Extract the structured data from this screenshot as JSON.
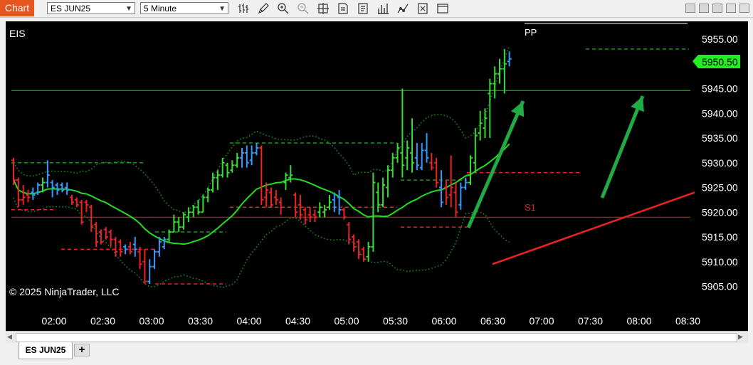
{
  "window": {
    "title": "Chart",
    "instrument": "ES JUN25",
    "interval": "5 Minute",
    "tab_label": "ES JUN25",
    "add_tab_label": "+"
  },
  "toolbar_icons": [
    "bar-type-icon",
    "draw-pencil-icon",
    "zoom-in-icon",
    "zoom-out-icon",
    "crosshair-icon",
    "data-box-icon",
    "properties-icon",
    "strategies-icon",
    "indicators-icon",
    "templates-icon",
    "window-menu-icon"
  ],
  "chart": {
    "instrument_label": "EIS",
    "copyright": "© 2025 NinjaTrader, LLC",
    "price_label": "5950.50",
    "pivot_label": "PP",
    "s1_label": "S1",
    "price_ticks": [
      "5955.00",
      "5950.00",
      "5945.00",
      "5940.00",
      "5935.00",
      "5930.00",
      "5925.00",
      "5920.00",
      "5915.00",
      "5910.00",
      "5905.00"
    ],
    "time_ticks": [
      "02:00",
      "02:30",
      "03:00",
      "03:30",
      "04:00",
      "04:30",
      "05:00",
      "05:30",
      "06:00",
      "06:30",
      "07:00",
      "07:30",
      "08:00",
      "08:30"
    ],
    "colors": {
      "background": "#000000",
      "up_bar": "#33dd33",
      "down_bar": "#ee2222",
      "neutral_bar": "#3399ff",
      "ma": "#22dd22",
      "bollinger": "#1a9a1a",
      "pivot_line": "#22cc22",
      "s1_line": "#dd2222",
      "price_marker": "#22ee22",
      "arrow": "#22aa44"
    }
  },
  "chart_data": {
    "type": "candlestick",
    "instrument": "EIS",
    "interval": "5 Minute",
    "ylim": [
      5903,
      5958
    ],
    "levels": {
      "PP": 5944.6,
      "S1": 5919
    },
    "last_price": 5950.5,
    "bars": [
      {
        "o": 5930.5,
        "h": 5931,
        "l": 5925.5,
        "c": 5926.5,
        "d": "down"
      },
      {
        "o": 5926.5,
        "h": 5927,
        "l": 5921,
        "c": 5922.5,
        "d": "down"
      },
      {
        "o": 5922.5,
        "h": 5925.5,
        "l": 5921.5,
        "c": 5923,
        "d": "down"
      },
      {
        "o": 5923.5,
        "h": 5924.5,
        "l": 5922,
        "c": 5923,
        "d": "down"
      },
      {
        "o": 5924,
        "h": 5925,
        "l": 5922.5,
        "c": 5923.5,
        "d": "neutral"
      },
      {
        "o": 5924,
        "h": 5926,
        "l": 5923.5,
        "c": 5925.5,
        "d": "neutral"
      },
      {
        "o": 5925.5,
        "h": 5927,
        "l": 5924,
        "c": 5926,
        "d": "up"
      },
      {
        "o": 5926,
        "h": 5930.5,
        "l": 5925,
        "c": 5927.5,
        "d": "neutral"
      },
      {
        "o": 5926,
        "h": 5926.5,
        "l": 5923,
        "c": 5925,
        "d": "neutral"
      },
      {
        "o": 5925.5,
        "h": 5926,
        "l": 5923.5,
        "c": 5924.5,
        "d": "neutral"
      },
      {
        "o": 5925.5,
        "h": 5926,
        "l": 5924,
        "c": 5924.5,
        "d": "neutral"
      },
      {
        "o": 5925,
        "h": 5926,
        "l": 5923.5,
        "c": 5924.5,
        "d": "neutral"
      },
      {
        "o": 5923,
        "h": 5923.5,
        "l": 5921.5,
        "c": 5922,
        "d": "down"
      },
      {
        "o": 5922.5,
        "h": 5923,
        "l": 5921,
        "c": 5921.5,
        "d": "down"
      },
      {
        "o": 5922,
        "h": 5922.5,
        "l": 5917.5,
        "c": 5918,
        "d": "down"
      },
      {
        "o": 5922,
        "h": 5922.5,
        "l": 5920,
        "c": 5921.5,
        "d": "down"
      },
      {
        "o": 5921,
        "h": 5921.5,
        "l": 5916,
        "c": 5917,
        "d": "down"
      },
      {
        "o": 5917.5,
        "h": 5918,
        "l": 5913,
        "c": 5914,
        "d": "down"
      },
      {
        "o": 5916,
        "h": 5916.5,
        "l": 5913.5,
        "c": 5914,
        "d": "down"
      },
      {
        "o": 5916.5,
        "h": 5917,
        "l": 5914.5,
        "c": 5915,
        "d": "down"
      },
      {
        "o": 5916,
        "h": 5916.5,
        "l": 5913,
        "c": 5914.5,
        "d": "down"
      },
      {
        "o": 5914.5,
        "h": 5915,
        "l": 5911,
        "c": 5912,
        "d": "down"
      },
      {
        "o": 5914,
        "h": 5914.5,
        "l": 5911,
        "c": 5912,
        "d": "down"
      },
      {
        "o": 5913,
        "h": 5913.5,
        "l": 5911.5,
        "c": 5912.5,
        "d": "neutral"
      },
      {
        "o": 5913,
        "h": 5914,
        "l": 5911.5,
        "c": 5912,
        "d": "down"
      },
      {
        "o": 5913.5,
        "h": 5915,
        "l": 5911,
        "c": 5912.5,
        "d": "neutral"
      },
      {
        "o": 5912,
        "h": 5913,
        "l": 5908.5,
        "c": 5909.5,
        "d": "down"
      },
      {
        "o": 5910,
        "h": 5912.5,
        "l": 5905.5,
        "c": 5906,
        "d": "down"
      },
      {
        "o": 5906,
        "h": 5910.5,
        "l": 5905.5,
        "c": 5909,
        "d": "neutral"
      },
      {
        "o": 5909,
        "h": 5912.5,
        "l": 5908.5,
        "c": 5912,
        "d": "neutral"
      },
      {
        "o": 5912,
        "h": 5915,
        "l": 5911,
        "c": 5914,
        "d": "neutral"
      },
      {
        "o": 5913,
        "h": 5915,
        "l": 5912.5,
        "c": 5914.5,
        "d": "neutral"
      },
      {
        "o": 5914.5,
        "h": 5916.5,
        "l": 5914,
        "c": 5916,
        "d": "up"
      },
      {
        "o": 5916,
        "h": 5919.5,
        "l": 5916,
        "c": 5918,
        "d": "up"
      },
      {
        "o": 5918,
        "h": 5919,
        "l": 5916,
        "c": 5917,
        "d": "up"
      },
      {
        "o": 5917,
        "h": 5920,
        "l": 5916.5,
        "c": 5919.5,
        "d": "up"
      },
      {
        "o": 5919,
        "h": 5921,
        "l": 5918,
        "c": 5920,
        "d": "up"
      },
      {
        "o": 5920,
        "h": 5921.5,
        "l": 5919,
        "c": 5921,
        "d": "up"
      },
      {
        "o": 5921,
        "h": 5922.5,
        "l": 5919.5,
        "c": 5920,
        "d": "up"
      },
      {
        "o": 5920,
        "h": 5923.5,
        "l": 5920,
        "c": 5923,
        "d": "up"
      },
      {
        "o": 5923,
        "h": 5925,
        "l": 5922,
        "c": 5924.5,
        "d": "up"
      },
      {
        "o": 5924.5,
        "h": 5928,
        "l": 5924,
        "c": 5927,
        "d": "up"
      },
      {
        "o": 5927,
        "h": 5928.5,
        "l": 5924.5,
        "c": 5927.5,
        "d": "up"
      },
      {
        "o": 5927.5,
        "h": 5931,
        "l": 5927,
        "c": 5930,
        "d": "up"
      },
      {
        "o": 5929.5,
        "h": 5930,
        "l": 5927,
        "c": 5928,
        "d": "up"
      },
      {
        "o": 5928.5,
        "h": 5930.5,
        "l": 5928,
        "c": 5929.5,
        "d": "up"
      },
      {
        "o": 5929.5,
        "h": 5932,
        "l": 5929,
        "c": 5931,
        "d": "up"
      },
      {
        "o": 5931,
        "h": 5933,
        "l": 5929,
        "c": 5932,
        "d": "neutral"
      },
      {
        "o": 5932,
        "h": 5933.5,
        "l": 5929,
        "c": 5930,
        "d": "neutral"
      },
      {
        "o": 5930.5,
        "h": 5933.5,
        "l": 5929.5,
        "c": 5932,
        "d": "neutral"
      },
      {
        "o": 5932,
        "h": 5934,
        "l": 5931.5,
        "c": 5933,
        "d": "neutral"
      },
      {
        "o": 5933,
        "h": 5933.5,
        "l": 5921.5,
        "c": 5922.5,
        "d": "down"
      },
      {
        "o": 5923,
        "h": 5926,
        "l": 5921,
        "c": 5924.5,
        "d": "down"
      },
      {
        "o": 5924,
        "h": 5925,
        "l": 5921,
        "c": 5921.5,
        "d": "down"
      },
      {
        "o": 5923,
        "h": 5924.5,
        "l": 5921.5,
        "c": 5922.5,
        "d": "down"
      },
      {
        "o": 5922,
        "h": 5923,
        "l": 5919.5,
        "c": 5921,
        "d": "down"
      },
      {
        "o": 5926,
        "h": 5928,
        "l": 5924.5,
        "c": 5927.5,
        "d": "up"
      },
      {
        "o": 5927,
        "h": 5929.5,
        "l": 5926,
        "c": 5927.5,
        "d": "up"
      },
      {
        "o": 5923.5,
        "h": 5924,
        "l": 5919,
        "c": 5920,
        "d": "down"
      },
      {
        "o": 5921.5,
        "h": 5923.5,
        "l": 5918.5,
        "c": 5919.5,
        "d": "down"
      },
      {
        "o": 5920.5,
        "h": 5921,
        "l": 5917.5,
        "c": 5918.5,
        "d": "down"
      },
      {
        "o": 5919.5,
        "h": 5921,
        "l": 5918,
        "c": 5919,
        "d": "down"
      },
      {
        "o": 5919.5,
        "h": 5920.5,
        "l": 5918,
        "c": 5919,
        "d": "down"
      },
      {
        "o": 5920,
        "h": 5922,
        "l": 5919,
        "c": 5921,
        "d": "up"
      },
      {
        "o": 5920,
        "h": 5921.5,
        "l": 5919,
        "c": 5920.5,
        "d": "up"
      },
      {
        "o": 5921,
        "h": 5923.5,
        "l": 5920.5,
        "c": 5922,
        "d": "up"
      },
      {
        "o": 5922.5,
        "h": 5924,
        "l": 5920,
        "c": 5921,
        "d": "neutral"
      },
      {
        "o": 5923,
        "h": 5924.5,
        "l": 5919.5,
        "c": 5920.5,
        "d": "neutral"
      },
      {
        "o": 5920.5,
        "h": 5921,
        "l": 5918.5,
        "c": 5919,
        "d": "down"
      },
      {
        "o": 5917.5,
        "h": 5918,
        "l": 5913.5,
        "c": 5914.5,
        "d": "down"
      },
      {
        "o": 5915,
        "h": 5915.5,
        "l": 5912,
        "c": 5913,
        "d": "down"
      },
      {
        "o": 5914,
        "h": 5914.5,
        "l": 5910.5,
        "c": 5911.5,
        "d": "down"
      },
      {
        "o": 5912.5,
        "h": 5913,
        "l": 5910,
        "c": 5910.5,
        "d": "down"
      },
      {
        "o": 5911,
        "h": 5914,
        "l": 5910,
        "c": 5913,
        "d": "up"
      },
      {
        "o": 5913,
        "h": 5928,
        "l": 5912,
        "c": 5926,
        "d": "up"
      },
      {
        "o": 5924,
        "h": 5926,
        "l": 5920,
        "c": 5921.5,
        "d": "up"
      },
      {
        "o": 5921.5,
        "h": 5927,
        "l": 5921,
        "c": 5925.5,
        "d": "up"
      },
      {
        "o": 5925,
        "h": 5929.5,
        "l": 5923,
        "c": 5928.5,
        "d": "up"
      },
      {
        "o": 5928.5,
        "h": 5932,
        "l": 5927,
        "c": 5931,
        "d": "up"
      },
      {
        "o": 5931,
        "h": 5934,
        "l": 5930,
        "c": 5933,
        "d": "up"
      },
      {
        "o": 5932,
        "h": 5945,
        "l": 5927,
        "c": 5929.5,
        "d": "up"
      },
      {
        "o": 5931,
        "h": 5934.5,
        "l": 5928.5,
        "c": 5933,
        "d": "up"
      },
      {
        "o": 5932,
        "h": 5939,
        "l": 5928,
        "c": 5930,
        "d": "up"
      },
      {
        "o": 5931,
        "h": 5934,
        "l": 5928.5,
        "c": 5929.5,
        "d": "neutral"
      },
      {
        "o": 5929,
        "h": 5934,
        "l": 5928.5,
        "c": 5932.5,
        "d": "neutral"
      },
      {
        "o": 5932.5,
        "h": 5936,
        "l": 5930,
        "c": 5931,
        "d": "neutral"
      },
      {
        "o": 5930,
        "h": 5932,
        "l": 5928.5,
        "c": 5929,
        "d": "down"
      },
      {
        "o": 5930,
        "h": 5931,
        "l": 5925,
        "c": 5926,
        "d": "down"
      },
      {
        "o": 5925,
        "h": 5928.5,
        "l": 5921,
        "c": 5922,
        "d": "neutral"
      },
      {
        "o": 5925,
        "h": 5926.5,
        "l": 5921.5,
        "c": 5923,
        "d": "down"
      },
      {
        "o": 5923.5,
        "h": 5931.5,
        "l": 5921,
        "c": 5925,
        "d": "down"
      },
      {
        "o": 5924,
        "h": 5926,
        "l": 5919,
        "c": 5920,
        "d": "down"
      },
      {
        "o": 5921.5,
        "h": 5926,
        "l": 5920.5,
        "c": 5925,
        "d": "neutral"
      },
      {
        "o": 5925,
        "h": 5927,
        "l": 5924.5,
        "c": 5926,
        "d": "neutral"
      },
      {
        "o": 5926,
        "h": 5931.5,
        "l": 5925.5,
        "c": 5931,
        "d": "up"
      },
      {
        "o": 5930,
        "h": 5937,
        "l": 5928,
        "c": 5935.5,
        "d": "up"
      },
      {
        "o": 5936,
        "h": 5940.5,
        "l": 5934.5,
        "c": 5938,
        "d": "up"
      },
      {
        "o": 5937,
        "h": 5941,
        "l": 5935,
        "c": 5939,
        "d": "up"
      },
      {
        "o": 5944,
        "h": 5947,
        "l": 5935,
        "c": 5946,
        "d": "up"
      },
      {
        "o": 5946,
        "h": 5949.5,
        "l": 5943,
        "c": 5948,
        "d": "up"
      },
      {
        "o": 5948,
        "h": 5951,
        "l": 5946,
        "c": 5949,
        "d": "up"
      },
      {
        "o": 5949,
        "h": 5953,
        "l": 5944,
        "c": 5950,
        "d": "up"
      },
      {
        "o": 5950.5,
        "h": 5952.5,
        "l": 5949.5,
        "c": 5951,
        "d": "neutral"
      }
    ]
  }
}
